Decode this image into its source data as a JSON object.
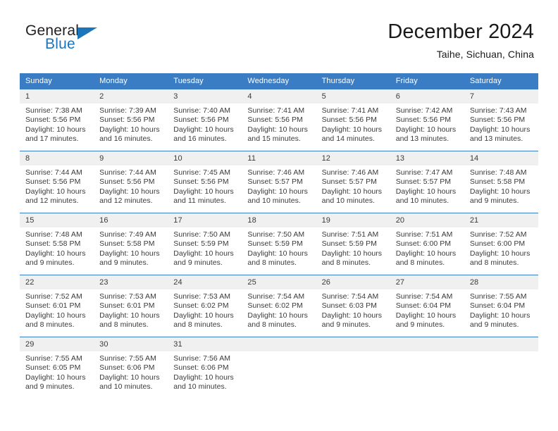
{
  "brand": {
    "name_top": "General",
    "name_bottom": "Blue",
    "triangle_icon": "triangle-icon",
    "accent_color": "#1b75bb"
  },
  "header": {
    "title": "December 2024",
    "subtitle": "Taihe, Sichuan, China"
  },
  "theme": {
    "header_blue": "#3b7dc4",
    "daynum_band": "#f0f0f0",
    "text": "#3a3a3a"
  },
  "calendar": {
    "weekday_headers": [
      "Sunday",
      "Monday",
      "Tuesday",
      "Wednesday",
      "Thursday",
      "Friday",
      "Saturday"
    ],
    "weeks": [
      [
        {
          "day": "1",
          "sunrise": "Sunrise: 7:38 AM",
          "sunset": "Sunset: 5:56 PM",
          "daylight_line1": "Daylight: 10 hours",
          "daylight_line2": "and 17 minutes."
        },
        {
          "day": "2",
          "sunrise": "Sunrise: 7:39 AM",
          "sunset": "Sunset: 5:56 PM",
          "daylight_line1": "Daylight: 10 hours",
          "daylight_line2": "and 16 minutes."
        },
        {
          "day": "3",
          "sunrise": "Sunrise: 7:40 AM",
          "sunset": "Sunset: 5:56 PM",
          "daylight_line1": "Daylight: 10 hours",
          "daylight_line2": "and 16 minutes."
        },
        {
          "day": "4",
          "sunrise": "Sunrise: 7:41 AM",
          "sunset": "Sunset: 5:56 PM",
          "daylight_line1": "Daylight: 10 hours",
          "daylight_line2": "and 15 minutes."
        },
        {
          "day": "5",
          "sunrise": "Sunrise: 7:41 AM",
          "sunset": "Sunset: 5:56 PM",
          "daylight_line1": "Daylight: 10 hours",
          "daylight_line2": "and 14 minutes."
        },
        {
          "day": "6",
          "sunrise": "Sunrise: 7:42 AM",
          "sunset": "Sunset: 5:56 PM",
          "daylight_line1": "Daylight: 10 hours",
          "daylight_line2": "and 13 minutes."
        },
        {
          "day": "7",
          "sunrise": "Sunrise: 7:43 AM",
          "sunset": "Sunset: 5:56 PM",
          "daylight_line1": "Daylight: 10 hours",
          "daylight_line2": "and 13 minutes."
        }
      ],
      [
        {
          "day": "8",
          "sunrise": "Sunrise: 7:44 AM",
          "sunset": "Sunset: 5:56 PM",
          "daylight_line1": "Daylight: 10 hours",
          "daylight_line2": "and 12 minutes."
        },
        {
          "day": "9",
          "sunrise": "Sunrise: 7:44 AM",
          "sunset": "Sunset: 5:56 PM",
          "daylight_line1": "Daylight: 10 hours",
          "daylight_line2": "and 12 minutes."
        },
        {
          "day": "10",
          "sunrise": "Sunrise: 7:45 AM",
          "sunset": "Sunset: 5:56 PM",
          "daylight_line1": "Daylight: 10 hours",
          "daylight_line2": "and 11 minutes."
        },
        {
          "day": "11",
          "sunrise": "Sunrise: 7:46 AM",
          "sunset": "Sunset: 5:57 PM",
          "daylight_line1": "Daylight: 10 hours",
          "daylight_line2": "and 10 minutes."
        },
        {
          "day": "12",
          "sunrise": "Sunrise: 7:46 AM",
          "sunset": "Sunset: 5:57 PM",
          "daylight_line1": "Daylight: 10 hours",
          "daylight_line2": "and 10 minutes."
        },
        {
          "day": "13",
          "sunrise": "Sunrise: 7:47 AM",
          "sunset": "Sunset: 5:57 PM",
          "daylight_line1": "Daylight: 10 hours",
          "daylight_line2": "and 10 minutes."
        },
        {
          "day": "14",
          "sunrise": "Sunrise: 7:48 AM",
          "sunset": "Sunset: 5:58 PM",
          "daylight_line1": "Daylight: 10 hours",
          "daylight_line2": "and 9 minutes."
        }
      ],
      [
        {
          "day": "15",
          "sunrise": "Sunrise: 7:48 AM",
          "sunset": "Sunset: 5:58 PM",
          "daylight_line1": "Daylight: 10 hours",
          "daylight_line2": "and 9 minutes."
        },
        {
          "day": "16",
          "sunrise": "Sunrise: 7:49 AM",
          "sunset": "Sunset: 5:58 PM",
          "daylight_line1": "Daylight: 10 hours",
          "daylight_line2": "and 9 minutes."
        },
        {
          "day": "17",
          "sunrise": "Sunrise: 7:50 AM",
          "sunset": "Sunset: 5:59 PM",
          "daylight_line1": "Daylight: 10 hours",
          "daylight_line2": "and 9 minutes."
        },
        {
          "day": "18",
          "sunrise": "Sunrise: 7:50 AM",
          "sunset": "Sunset: 5:59 PM",
          "daylight_line1": "Daylight: 10 hours",
          "daylight_line2": "and 8 minutes."
        },
        {
          "day": "19",
          "sunrise": "Sunrise: 7:51 AM",
          "sunset": "Sunset: 5:59 PM",
          "daylight_line1": "Daylight: 10 hours",
          "daylight_line2": "and 8 minutes."
        },
        {
          "day": "20",
          "sunrise": "Sunrise: 7:51 AM",
          "sunset": "Sunset: 6:00 PM",
          "daylight_line1": "Daylight: 10 hours",
          "daylight_line2": "and 8 minutes."
        },
        {
          "day": "21",
          "sunrise": "Sunrise: 7:52 AM",
          "sunset": "Sunset: 6:00 PM",
          "daylight_line1": "Daylight: 10 hours",
          "daylight_line2": "and 8 minutes."
        }
      ],
      [
        {
          "day": "22",
          "sunrise": "Sunrise: 7:52 AM",
          "sunset": "Sunset: 6:01 PM",
          "daylight_line1": "Daylight: 10 hours",
          "daylight_line2": "and 8 minutes."
        },
        {
          "day": "23",
          "sunrise": "Sunrise: 7:53 AM",
          "sunset": "Sunset: 6:01 PM",
          "daylight_line1": "Daylight: 10 hours",
          "daylight_line2": "and 8 minutes."
        },
        {
          "day": "24",
          "sunrise": "Sunrise: 7:53 AM",
          "sunset": "Sunset: 6:02 PM",
          "daylight_line1": "Daylight: 10 hours",
          "daylight_line2": "and 8 minutes."
        },
        {
          "day": "25",
          "sunrise": "Sunrise: 7:54 AM",
          "sunset": "Sunset: 6:02 PM",
          "daylight_line1": "Daylight: 10 hours",
          "daylight_line2": "and 8 minutes."
        },
        {
          "day": "26",
          "sunrise": "Sunrise: 7:54 AM",
          "sunset": "Sunset: 6:03 PM",
          "daylight_line1": "Daylight: 10 hours",
          "daylight_line2": "and 9 minutes."
        },
        {
          "day": "27",
          "sunrise": "Sunrise: 7:54 AM",
          "sunset": "Sunset: 6:04 PM",
          "daylight_line1": "Daylight: 10 hours",
          "daylight_line2": "and 9 minutes."
        },
        {
          "day": "28",
          "sunrise": "Sunrise: 7:55 AM",
          "sunset": "Sunset: 6:04 PM",
          "daylight_line1": "Daylight: 10 hours",
          "daylight_line2": "and 9 minutes."
        }
      ],
      [
        {
          "day": "29",
          "sunrise": "Sunrise: 7:55 AM",
          "sunset": "Sunset: 6:05 PM",
          "daylight_line1": "Daylight: 10 hours",
          "daylight_line2": "and 9 minutes."
        },
        {
          "day": "30",
          "sunrise": "Sunrise: 7:55 AM",
          "sunset": "Sunset: 6:06 PM",
          "daylight_line1": "Daylight: 10 hours",
          "daylight_line2": "and 10 minutes."
        },
        {
          "day": "31",
          "sunrise": "Sunrise: 7:56 AM",
          "sunset": "Sunset: 6:06 PM",
          "daylight_line1": "Daylight: 10 hours",
          "daylight_line2": "and 10 minutes."
        },
        {
          "day": "",
          "sunrise": "",
          "sunset": "",
          "daylight_line1": "",
          "daylight_line2": ""
        },
        {
          "day": "",
          "sunrise": "",
          "sunset": "",
          "daylight_line1": "",
          "daylight_line2": ""
        },
        {
          "day": "",
          "sunrise": "",
          "sunset": "",
          "daylight_line1": "",
          "daylight_line2": ""
        },
        {
          "day": "",
          "sunrise": "",
          "sunset": "",
          "daylight_line1": "",
          "daylight_line2": ""
        }
      ]
    ]
  }
}
